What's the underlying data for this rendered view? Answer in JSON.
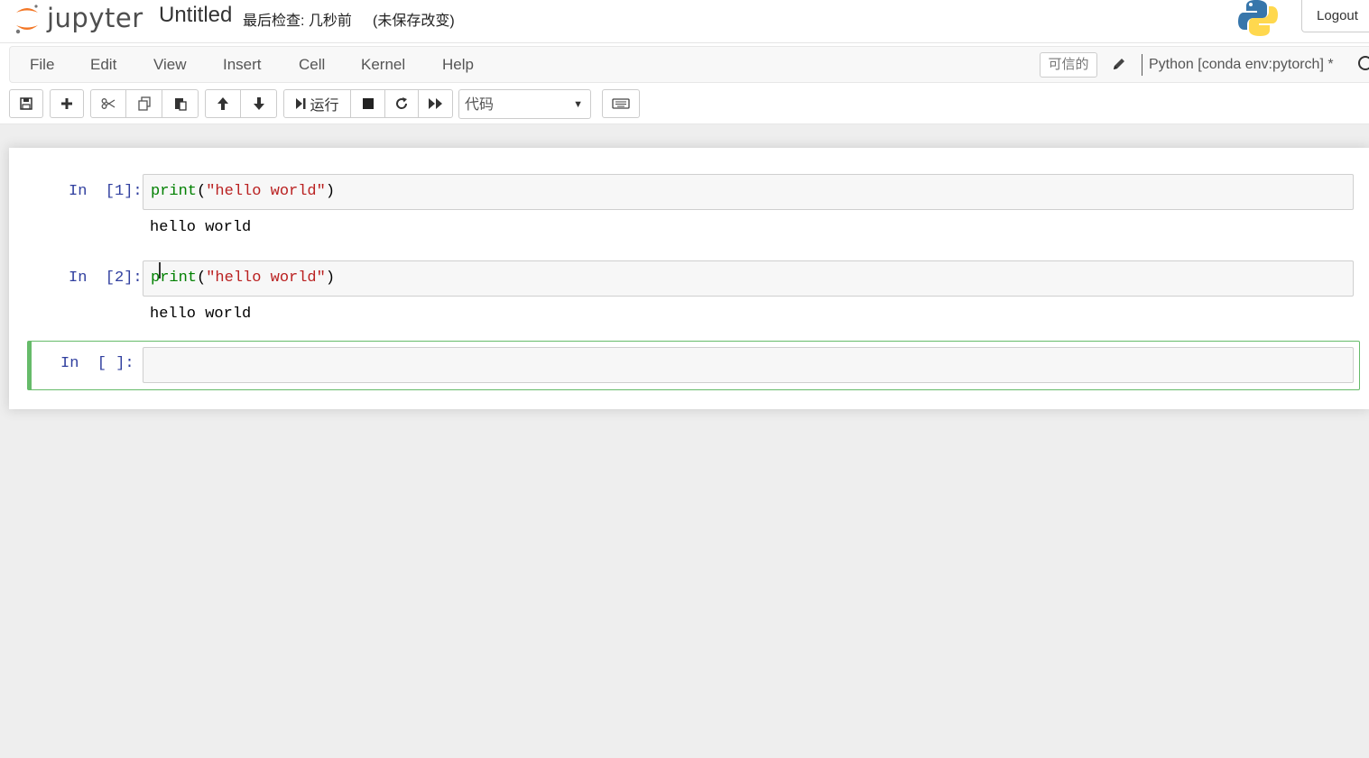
{
  "header": {
    "logo_text": "jupyter",
    "notebook_title": "Untitled",
    "checkpoint": "最后检查: 几秒前",
    "autosave_status": "(未保存改变)",
    "logout_label": "Logout"
  },
  "menubar": {
    "items": [
      "File",
      "Edit",
      "View",
      "Insert",
      "Cell",
      "Kernel",
      "Help"
    ],
    "trusted_label": "可信的",
    "kernel_name": "Python [conda env:pytorch] *"
  },
  "toolbar": {
    "run_label": "运行",
    "cell_type_value": "代码",
    "icons": [
      "save-icon",
      "plus-icon",
      "cut-icon",
      "copy-icon",
      "paste-icon",
      "arrow-up-icon",
      "arrow-down-icon",
      "run-icon",
      "stop-icon",
      "restart-icon",
      "fast-forward-icon",
      "keyboard-icon"
    ]
  },
  "cells": [
    {
      "prompt": "In  [1]:",
      "code_fn": "print",
      "code_open": "(",
      "code_str": "\"hello world\"",
      "code_close": ")",
      "output": "hello world"
    },
    {
      "prompt": "In  [2]:",
      "code_fn": "print",
      "code_open": "(",
      "code_str": "\"hello world\"",
      "code_close": ")",
      "output": "hello world"
    },
    {
      "prompt": "In  [ ]:",
      "code": ""
    }
  ],
  "colors": {
    "prompt": "#303f9f",
    "keyword": "#008000",
    "string": "#ba2121",
    "selected_border": "#66bb6a"
  }
}
